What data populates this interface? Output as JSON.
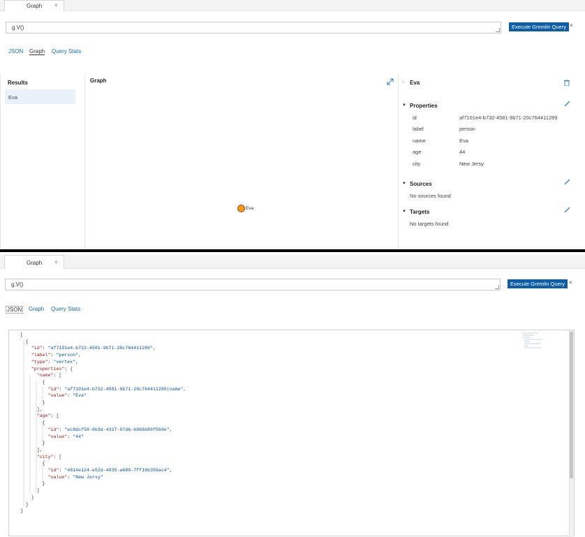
{
  "top": {
    "tab_label": "Graph",
    "tab_close": "×",
    "query_value": "g.V()",
    "execute_label": "Execute Gremlin Query",
    "close_label": "×",
    "view_tabs": [
      "JSON",
      "Graph",
      "Query Stats"
    ],
    "results_title": "Results",
    "result_item": "Eva",
    "graph_title": "Graph",
    "node_label": "Eva",
    "node_color": "#f39c12",
    "selected_title": "Eva",
    "properties_title": "Properties",
    "properties": [
      {
        "key": "id",
        "value": "af7101e4-b732-4581-9b71-20c764411289"
      },
      {
        "key": "label",
        "value": "person"
      },
      {
        "key": "name",
        "value": "Eva"
      },
      {
        "key": "age",
        "value": "44"
      },
      {
        "key": "city",
        "value": "New Jersy"
      }
    ],
    "sources_title": "Sources",
    "sources_empty": "No sources found",
    "targets_title": "Targets",
    "targets_empty": "No targets found"
  },
  "bottom": {
    "tab_label": "Graph",
    "tab_close": "×",
    "query_value": "g.V()",
    "execute_label": "Execute Gremlin Query",
    "close_label": "×",
    "view_tabs": [
      "JSON",
      "Graph",
      "Query Stats"
    ],
    "json_lines": [
      "[",
      "  {",
      "    \"id\": \"af7101e4-b732-4581-9b71-20c764411289\",",
      "    \"label\": \"person\",",
      "    \"type\": \"vertex\",",
      "    \"properties\": {",
      "      \"name\": [",
      "        {",
      "          \"id\": \"af7101e4-b732-4581-9b71-20c764411289|name\",",
      "          \"value\": \"Eva\"",
      "        }",
      "      ],",
      "      \"age\": [",
      "        {",
      "          \"id\": \"ec8dcf58-6b3d-4327-97db-b966b89f569e\",",
      "          \"value\": \"44\"",
      "        }",
      "      ],",
      "      \"city\": [",
      "        {",
      "          \"id\": \"4814e124-e52d-4935-a680-7ff16b359ac4\",",
      "          \"value\": \"New Jersy\"",
      "        }",
      "      ]",
      "    }",
      "  }",
      "]"
    ]
  },
  "colors": {
    "accent": "#0c5ea8",
    "link": "#1a6cb0",
    "icon": "#2d7dc8"
  }
}
